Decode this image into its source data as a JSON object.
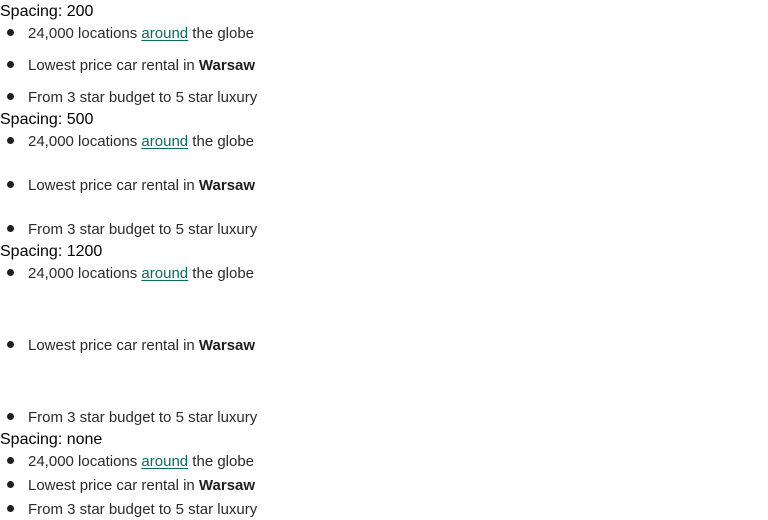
{
  "colors": {
    "text": "#2a2a2a",
    "heading": "#000000",
    "link": "#0a6b5a",
    "bullet": "#1f1f1f"
  },
  "groups": [
    {
      "heading": "Spacing: 200",
      "items": [
        {
          "before": "24,000 locations ",
          "link": "around",
          "after": " the globe"
        },
        {
          "before": "Lowest price car rental in ",
          "strong": "Warsaw"
        },
        {
          "before": "From 3 star budget to 5 star luxury"
        }
      ]
    },
    {
      "heading": "Spacing: 500",
      "items": [
        {
          "before": "24,000 locations ",
          "link": "around",
          "after": " the globe"
        },
        {
          "before": "Lowest price car rental in ",
          "strong": "Warsaw"
        },
        {
          "before": "From 3 star budget to 5 star luxury"
        }
      ]
    },
    {
      "heading": "Spacing: 1200",
      "items": [
        {
          "before": "24,000 locations ",
          "link": "around",
          "after": " the globe"
        },
        {
          "before": "Lowest price car rental in ",
          "strong": "Warsaw"
        },
        {
          "before": "From 3 star budget to 5 star luxury"
        }
      ]
    },
    {
      "heading": "Spacing: none",
      "items": [
        {
          "before": "24,000 locations ",
          "link": "around",
          "after": " the globe"
        },
        {
          "before": "Lowest price car rental in ",
          "strong": "Warsaw"
        },
        {
          "before": "From 3 star budget to 5 star luxury"
        }
      ]
    }
  ]
}
